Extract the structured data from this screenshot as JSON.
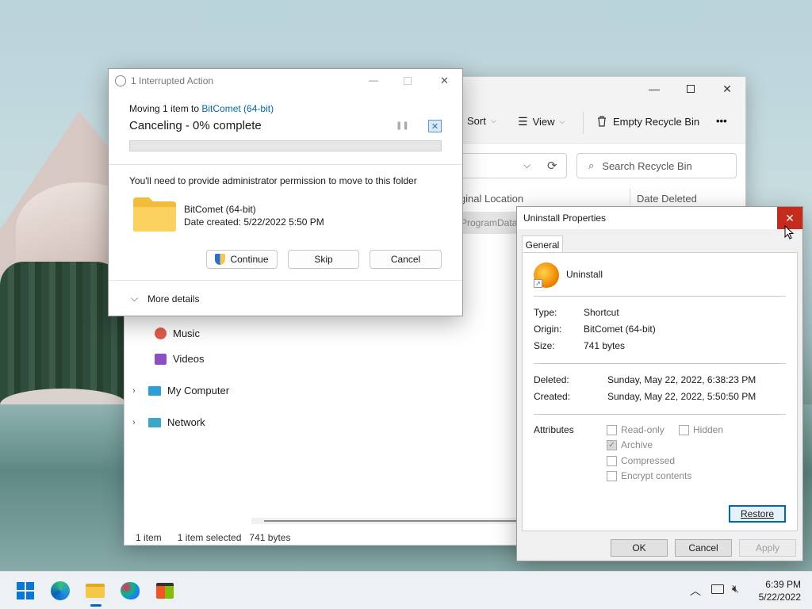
{
  "explorer": {
    "toolbar": {
      "sort": "Sort",
      "view": "View",
      "empty_recycle_bin": "Empty Recycle Bin",
      "more": "•••"
    },
    "search_placeholder": "Search Recycle Bin",
    "columns": {
      "original_location": "iginal Location",
      "date_deleted": "Date Deleted"
    },
    "row_location_partial": "ProgramData\\",
    "nav": {
      "music": "Music",
      "videos": "Videos",
      "my_computer": "My Computer",
      "network": "Network"
    },
    "status": {
      "count": "1 item",
      "selected": "1 item selected",
      "size": "741 bytes"
    }
  },
  "interrupted": {
    "title": "1 Interrupted Action",
    "moving_prefix": "Moving 1 item to ",
    "moving_target": "BitComet (64-bit)",
    "status": "Canceling - 0% complete",
    "progress": 0,
    "permission_text": "You'll need to provide administrator permission to move to this folder",
    "item_name": "BitComet (64-bit)",
    "item_date": "Date created: 5/22/2022 5:50 PM",
    "buttons": {
      "continue": "Continue",
      "skip": "Skip",
      "cancel": "Cancel"
    },
    "more_details": "More details"
  },
  "props": {
    "title": "Uninstall Properties",
    "tab": "General",
    "name": "Uninstall",
    "fields": [
      {
        "label": "Type:",
        "value": "Shortcut"
      },
      {
        "label": "Origin:",
        "value": "BitComet (64-bit)"
      },
      {
        "label": "Size:",
        "value": "741 bytes"
      }
    ],
    "dates": [
      {
        "label": "Deleted:",
        "value": "Sunday, May 22, 2022, 6:38:23 PM"
      },
      {
        "label": "Created:",
        "value": "Sunday, May 22, 2022, 5:50:50 PM"
      }
    ],
    "attributes_label": "Attributes",
    "attributes": {
      "readonly": "Read-only",
      "hidden": "Hidden",
      "archive": "Archive",
      "compressed": "Compressed",
      "encrypt": "Encrypt contents"
    },
    "buttons": {
      "restore": "Restore",
      "ok": "OK",
      "cancel": "Cancel",
      "apply": "Apply"
    }
  },
  "taskbar": {
    "time": "6:39 PM",
    "date": "5/22/2022"
  },
  "colors": {
    "accent": "#0067c0",
    "close_red": "#c42b1c",
    "folder": "#f5c845"
  }
}
